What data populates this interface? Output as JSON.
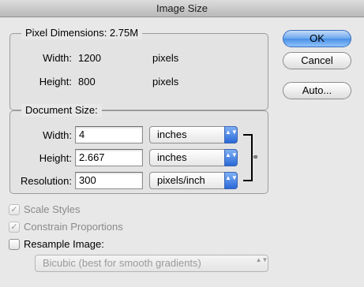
{
  "window": {
    "title": "Image Size"
  },
  "pixel_dimensions": {
    "legend": "Pixel Dimensions:  2.75M",
    "width_label": "Width:",
    "width_value": "1200",
    "width_unit": "pixels",
    "height_label": "Height:",
    "height_value": "800",
    "height_unit": "pixels"
  },
  "document_size": {
    "legend": "Document Size:",
    "width_label": "Width:",
    "width_value": "4",
    "width_unit": "inches",
    "height_label": "Height:",
    "height_value": "2.667",
    "height_unit": "inches",
    "resolution_label": "Resolution:",
    "resolution_value": "300",
    "resolution_unit": "pixels/inch",
    "link_icon": "chain-link-icon"
  },
  "options": {
    "scale_styles": {
      "label": "Scale Styles",
      "checked": true,
      "enabled": false
    },
    "constrain_proportions": {
      "label": "Constrain Proportions",
      "checked": true,
      "enabled": false
    },
    "resample_image": {
      "label": "Resample Image:",
      "checked": false,
      "enabled": true
    },
    "resample_method": {
      "value": "Bicubic (best for smooth gradients)",
      "enabled": false
    }
  },
  "buttons": {
    "ok": "OK",
    "cancel": "Cancel",
    "auto": "Auto..."
  },
  "glyphs": {
    "check": "✓",
    "updown": "▲▼",
    "link": "⚭"
  },
  "colors": {
    "default_button": "#6ba7ef",
    "popup_arrows": "#2a68d8"
  }
}
